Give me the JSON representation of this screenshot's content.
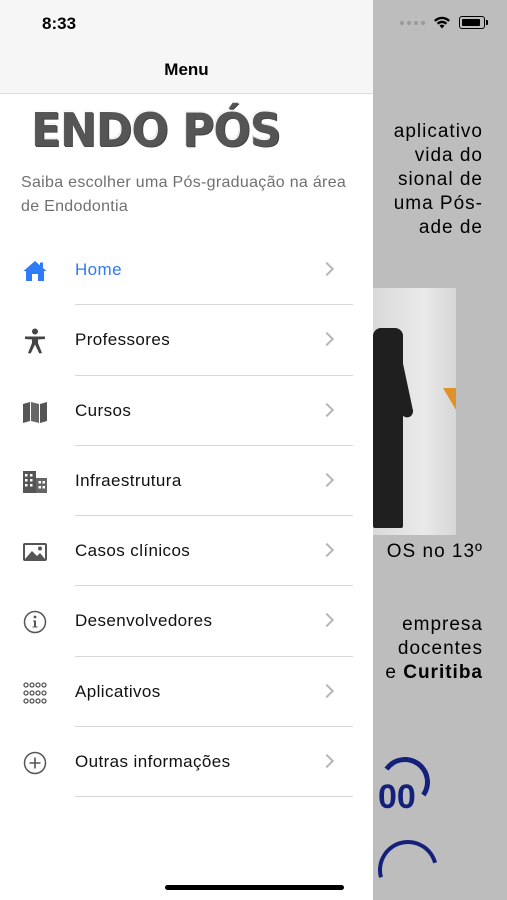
{
  "status": {
    "time": "8:33"
  },
  "drawer": {
    "title": "Menu",
    "logo_text": "ENDO PÓS",
    "tagline": "Saiba escolher uma Pós-graduação na área de Endodontia"
  },
  "menu": {
    "items": [
      {
        "label": "Home",
        "icon": "home-icon",
        "active": true
      },
      {
        "label": "Professores",
        "icon": "accessibility-icon",
        "active": false
      },
      {
        "label": "Cursos",
        "icon": "map-icon",
        "active": false
      },
      {
        "label": "Infraestrutura",
        "icon": "building-icon",
        "active": false
      },
      {
        "label": "Casos clínicos",
        "icon": "photo-icon",
        "active": false
      },
      {
        "label": "Desenvolvedores",
        "icon": "info-icon",
        "active": false
      },
      {
        "label": "Aplicativos",
        "icon": "grid-icon",
        "active": false
      },
      {
        "label": "Outras informações",
        "icon": "plus-circle-icon",
        "active": false
      }
    ]
  },
  "background": {
    "para1": [
      "aplicativo",
      "vida do",
      "sional de",
      "uma Pós-",
      "ade de"
    ],
    "para2": "OS no 13º",
    "para3_line1": "empresa",
    "para3_line2": "docentes",
    "para3_line3_prefix": "e ",
    "para3_line3_bold": "Curitiba"
  },
  "colors": {
    "accent": "#2f7af7",
    "icon": "#444444",
    "brand_blue": "#14207a"
  }
}
